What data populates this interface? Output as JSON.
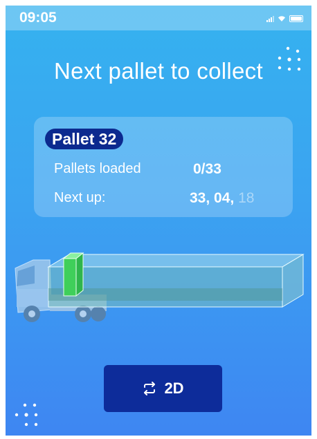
{
  "status_bar": {
    "time": "09:05"
  },
  "title": "Next pallet to collect",
  "card": {
    "pallet_label": "Pallet 32",
    "loaded_label": "Pallets loaded",
    "loaded_value": "0/33",
    "next_label": "Next up:",
    "next_values": [
      "33,",
      "04,",
      "18"
    ]
  },
  "view_button": {
    "icon": "swap-arrows-icon",
    "label": "2D"
  },
  "colors": {
    "accent": "#0d2c9a",
    "pallet_box": "#3fcf5a",
    "bg_top": "#35b2ef",
    "bg_bottom": "#3e86f2"
  }
}
